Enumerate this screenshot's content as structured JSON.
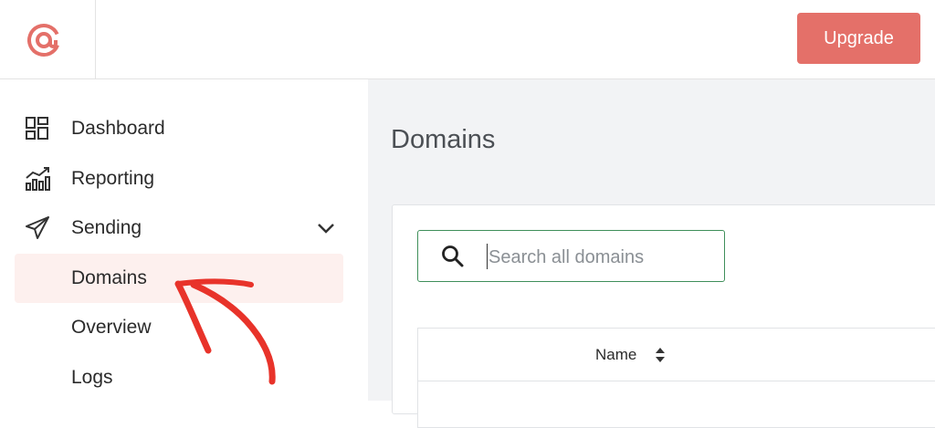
{
  "header": {
    "upgrade_label": "Upgrade",
    "brand_color": "#e47069"
  },
  "sidebar": {
    "items": [
      {
        "label": "Dashboard",
        "icon": "dashboard-icon"
      },
      {
        "label": "Reporting",
        "icon": "reporting-chart-icon"
      },
      {
        "label": "Sending",
        "icon": "paper-plane-icon",
        "expanded": true
      }
    ],
    "sending_children": [
      {
        "label": "Domains",
        "active": true
      },
      {
        "label": "Overview",
        "active": false
      },
      {
        "label": "Logs",
        "active": false
      }
    ]
  },
  "main": {
    "title": "Domains",
    "search": {
      "placeholder": "Search all domains",
      "value": ""
    },
    "table": {
      "columns": [
        {
          "label": "Name",
          "sortable": true
        }
      ]
    }
  },
  "annotation": {
    "type": "red-arrow",
    "target": "Domains",
    "color": "#e8332a"
  }
}
